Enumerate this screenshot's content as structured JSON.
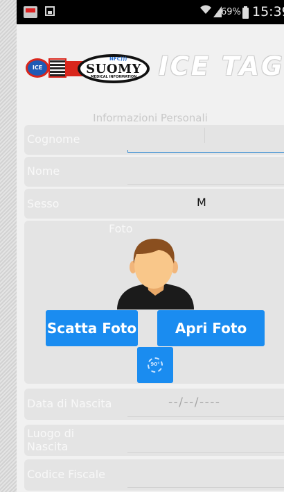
{
  "status_bar": {
    "battery_percent": "69%",
    "time": "15:39"
  },
  "logo": {
    "ice_badge": "ICE",
    "nfc_mark": "NFC)))",
    "brand": "SUOMY",
    "brand_sub": "MEDICAL INFORMATION",
    "product": "ICE TAG"
  },
  "form": {
    "section_title": "Informazioni Personali",
    "cognome_label": "Cognome",
    "nome_label": "Nome",
    "sesso_label": "Sesso",
    "sesso_value": "M",
    "foto_label": "Foto",
    "scatta_label": "Scatta Foto",
    "apri_label": "Apri Foto",
    "rotate_label": "90°",
    "data_nascita_label": "Data di Nascita",
    "data_nascita_value": "--/--/----",
    "luogo_label_line1": "Luogo di",
    "luogo_label_line2": "Nascita",
    "codice_fiscale_label": "Codice Fiscale"
  },
  "colors": {
    "accent": "#1a8cf0",
    "field_bg": "#e4e4e4",
    "page_bg": "#f1f1f1"
  }
}
